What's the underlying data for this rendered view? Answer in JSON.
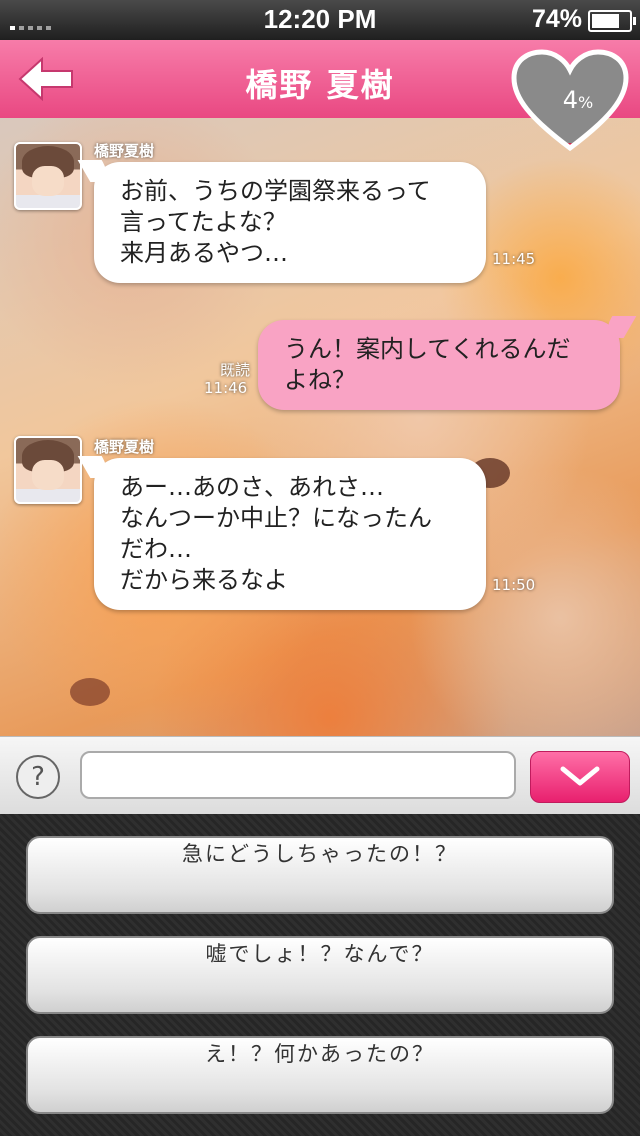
{
  "status": {
    "time": "12:20 PM",
    "battery": "74%",
    "battery_level": 0.74
  },
  "header": {
    "title": "橋野 夏樹",
    "affection": "4",
    "affection_unit": "%"
  },
  "messages": [
    {
      "sender": "橋野夏樹",
      "lines": [
        "お前、うちの学園祭来るって",
        "言ってたよな？",
        "来月あるやつ…"
      ],
      "time": "11:45"
    },
    {
      "lines": [
        "うん！案内してくれるんだ",
        "よね？"
      ],
      "read": "既読",
      "time": "11:46"
    },
    {
      "sender": "橋野夏樹",
      "lines": [
        "あー…あのさ、あれさ…",
        "なんつーか中止？になったん",
        "だわ…",
        "だから来るなよ"
      ],
      "time": "11:50"
    }
  ],
  "input": {
    "help": "?",
    "value": ""
  },
  "choices": [
    "急にどうしちゃったの！？",
    "嘘でしょ！？なんで？",
    "え！？何かあったの？"
  ],
  "colors": {
    "header_pink": "#f06c9f",
    "bubble_pink": "#f9a3c4",
    "send_pink": "#f0357f"
  }
}
